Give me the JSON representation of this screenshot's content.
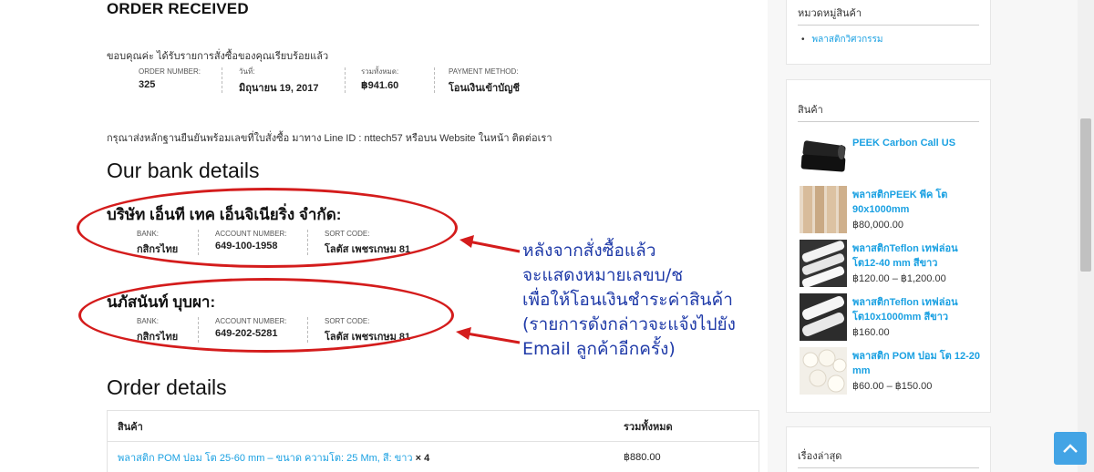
{
  "order": {
    "title": "ORDER RECEIVED",
    "thanks": "ขอบคุณค่ะ ได้รับรายการสั่งซื้อของคุณเรียบร้อยแล้ว",
    "overview": [
      {
        "label": "ORDER NUMBER:",
        "value": "325"
      },
      {
        "label": "วันที่:",
        "value": "มิถุนายน 19, 2017"
      },
      {
        "label": "รวมทั้งหมด:",
        "value": "฿941.60"
      },
      {
        "label": "PAYMENT METHOD:",
        "value": "โอนเงินเข้าบัญชี"
      }
    ],
    "instructions": "กรุณาส่งหลักฐานยืนยันพร้อมเลขที่ใบสั่งซื้อ มาทาง Line ID : nttech57 หรือบน Website ในหน้า ติดต่อเรา"
  },
  "bank": {
    "heading": "Our bank details",
    "accounts": [
      {
        "name": "บริษัท เอ็นที เทค เอ็นจิเนียริ่ง จำกัด:",
        "bank_label": "BANK:",
        "bank": "กสิกรไทย",
        "number_label": "ACCOUNT NUMBER:",
        "number": "649-100-1958",
        "sort_label": "SORT CODE:",
        "sort": "โลตัส เพชรเกษม 81"
      },
      {
        "name": "นภัสนันท์ บุบผา:",
        "bank_label": "BANK:",
        "bank": "กสิกรไทย",
        "number_label": "ACCOUNT NUMBER:",
        "number": "649-202-5281",
        "sort_label": "SORT CODE:",
        "sort": "โลตัส เพชรเกษม 81"
      }
    ]
  },
  "annotation": {
    "lines": [
      "หลังจากสั่งซื้อแล้ว",
      "จะแสดงหมายเลขบ/ช",
      "เพื่อให้โอนเงินชำระค่าสินค้า",
      "(รายการดังกล่าวจะแจ้งไปยัง",
      "Email ลูกค้าอีกครั้ง)"
    ],
    "color": "#1f3aa8",
    "highlight_color": "#d41c1c"
  },
  "order_details": {
    "heading": "Order details",
    "columns": [
      "สินค้า",
      "รวมทั้งหมด"
    ],
    "rows": [
      {
        "product": "พลาสติก POM ปอม โต 25-60 mm – ขนาด ความโต: 25 Mm, สี: ขาว",
        "qty": "× 4",
        "total": "฿880.00"
      }
    ]
  },
  "sidebar": {
    "categories_title": "หมวดหมู่สินค้า",
    "categories": [
      "พลาสติกวิศวกรรม"
    ],
    "products_title": "สินค้า",
    "products": [
      {
        "name": "PEEK Carbon Call US",
        "price": ""
      },
      {
        "name": "พลาสติกPEEK พีค โต 90x1000mm",
        "price": "฿80,000.00"
      },
      {
        "name": "พลาสติกTeflon เทฟล่อน โต12-40 mm สีขาว",
        "price": "฿120.00 – ฿1,200.00"
      },
      {
        "name": "พลาสติกTeflon เทฟล่อน โต10x1000mm สีขาว",
        "price": "฿160.00"
      },
      {
        "name": "พลาสติก POM ปอม โต 12-20 mm",
        "price": "฿60.00 – ฿150.00"
      }
    ],
    "recent_title": "เรื่องล่าสุด"
  },
  "colors": {
    "link": "#1ba1e2",
    "to_top": "#43a4e5"
  }
}
